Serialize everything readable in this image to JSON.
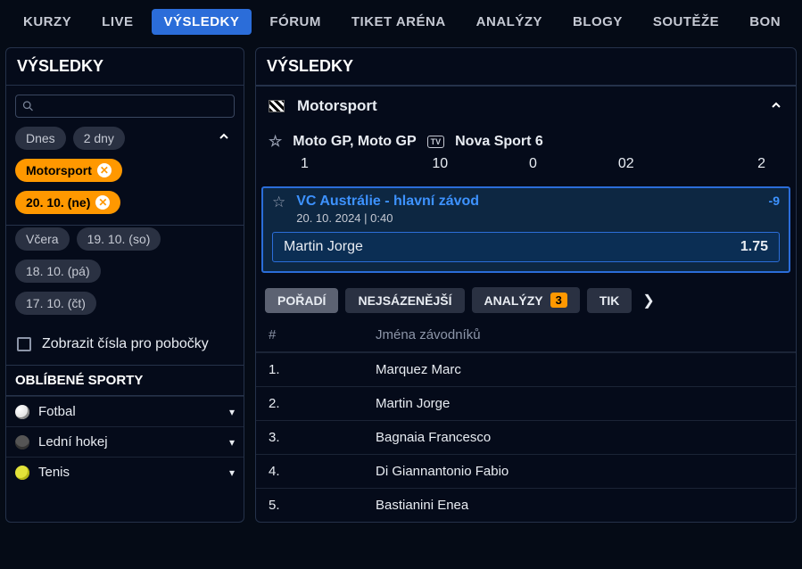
{
  "topnav": {
    "items": [
      "KURZY",
      "LIVE",
      "VÝSLEDKY",
      "FÓRUM",
      "TIKET ARÉNA",
      "ANALÝZY",
      "BLOGY",
      "SOUTĚŽE",
      "BON"
    ],
    "active_index": 2
  },
  "sidebar": {
    "title": "VÝSLEDKY",
    "search_placeholder": "",
    "quick": {
      "today": "Dnes",
      "two_days": "2 dny"
    },
    "active_filters": {
      "sport": "Motorsport",
      "date": "20. 10. (ne)"
    },
    "other_dates": [
      "Včera",
      "19. 10. (so)",
      "18. 10. (pá)",
      "17. 10. (čt)"
    ],
    "branch_toggle": "Zobrazit čísla pro pobočky",
    "fav_title": "OBLÍBENÉ SPORTY",
    "fav_sports": [
      {
        "label": "Fotbal",
        "icon": "soccer"
      },
      {
        "label": "Lední hokej",
        "icon": "puck"
      },
      {
        "label": "Tenis",
        "icon": "tennis"
      }
    ]
  },
  "main": {
    "title": "VÝSLEDKY",
    "sport_name": "Motorsport",
    "league": {
      "name": "Moto GP, Moto GP",
      "channel": "Nova Sport 6"
    },
    "market_numbers": [
      "1",
      "10",
      "0",
      "02",
      "2"
    ],
    "event": {
      "title": "VC Austrálie - hlavní závod",
      "datetime": "20. 10. 2024 | 0:40",
      "line_move": "-9",
      "pick_name": "Martin Jorge",
      "pick_odds": "1.75"
    },
    "tabs": {
      "items": [
        "POŘADÍ",
        "NEJSÁZENĚJŠÍ",
        "ANALÝZY",
        "TIK"
      ],
      "active_index": 0,
      "analyses_badge": "3"
    },
    "table": {
      "h_pos": "#",
      "h_name": "Jména závodníků",
      "rows": [
        {
          "pos": "1.",
          "name": "Marquez Marc"
        },
        {
          "pos": "2.",
          "name": "Martin Jorge"
        },
        {
          "pos": "3.",
          "name": "Bagnaia Francesco"
        },
        {
          "pos": "4.",
          "name": "Di Giannantonio Fabio"
        },
        {
          "pos": "5.",
          "name": "Bastianini Enea"
        }
      ]
    }
  }
}
